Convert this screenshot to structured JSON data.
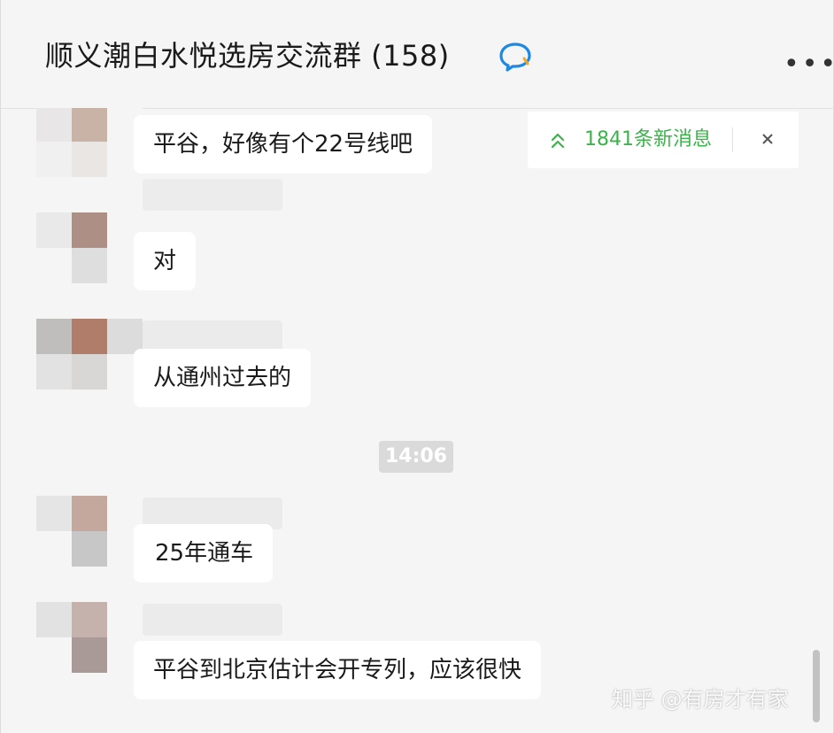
{
  "header": {
    "title": "顺义潮白水悦选房交流群 (158)",
    "icon": "chat-bubble-icon",
    "more": "more-icon"
  },
  "notification": {
    "label": "1841条新消息",
    "icon": "double-chevron-up-icon",
    "close_icon": "close-icon",
    "accent": "#3cb34a"
  },
  "messages": [
    {
      "text": "平谷，好像有个22号线吧"
    },
    {
      "text": "对"
    },
    {
      "text": "从通州过去的"
    },
    {
      "text": "25年通车"
    },
    {
      "text": "平谷到北京估计会开专列，应该很快"
    }
  ],
  "time_divider": "14:06",
  "watermark": "知乎 @有房才有家"
}
